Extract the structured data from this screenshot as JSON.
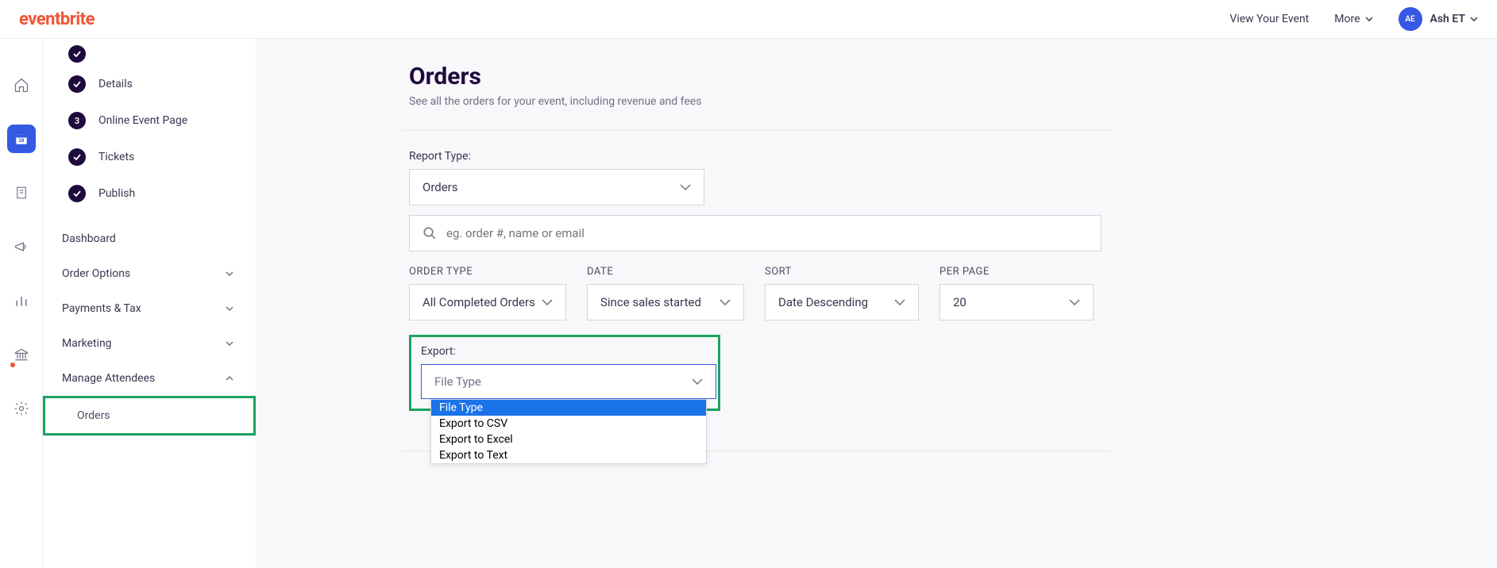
{
  "header": {
    "logo": "eventbrite",
    "view_event": "View Your Event",
    "more": "More",
    "avatar_initials": "AE",
    "user_name": "Ash ET"
  },
  "sidebar": {
    "items": [
      {
        "type": "check",
        "label": "Details"
      },
      {
        "type": "count",
        "count": "3",
        "label": "Online Event Page"
      },
      {
        "type": "check",
        "label": "Tickets"
      },
      {
        "type": "check",
        "label": "Publish"
      }
    ],
    "collapsible": [
      {
        "label": "Dashboard",
        "expanded": false,
        "has_chevron": false
      },
      {
        "label": "Order Options",
        "expanded": false,
        "has_chevron": true
      },
      {
        "label": "Payments & Tax",
        "expanded": false,
        "has_chevron": true
      },
      {
        "label": "Marketing",
        "expanded": false,
        "has_chevron": true
      },
      {
        "label": "Manage Attendees",
        "expanded": true,
        "has_chevron": true
      }
    ],
    "sub_items": [
      {
        "label": "Orders",
        "highlighted": true
      }
    ]
  },
  "main": {
    "title": "Orders",
    "subtitle": "See all the orders for your event, including revenue and fees",
    "report_type_label": "Report Type:",
    "report_type_value": "Orders",
    "search_placeholder": "eg. order #, name or email",
    "filters": {
      "order_type": {
        "label": "ORDER TYPE",
        "value": "All Completed Orders"
      },
      "date": {
        "label": "DATE",
        "value": "Since sales started"
      },
      "sort": {
        "label": "SORT",
        "value": "Date Descending"
      },
      "per_page": {
        "label": "PER PAGE",
        "value": "20"
      }
    },
    "export": {
      "label": "Export:",
      "placeholder": "File Type",
      "options": [
        "File Type",
        "Export to CSV",
        "Export to Excel",
        "Export to Text"
      ]
    }
  }
}
